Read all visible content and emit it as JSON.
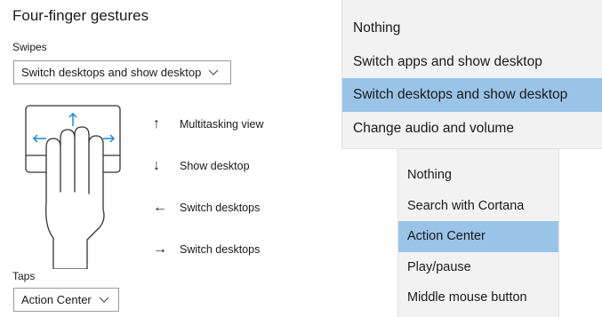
{
  "section_title": "Four-finger gestures",
  "swipes": {
    "label": "Swipes",
    "selected": "Switch desktops and show desktop"
  },
  "taps": {
    "label": "Taps",
    "selected": "Action Center"
  },
  "legend": [
    {
      "arrow": "↑",
      "icon": "arrow-up-icon",
      "label": "Multitasking view"
    },
    {
      "arrow": "↓",
      "icon": "arrow-down-icon",
      "label": "Show desktop"
    },
    {
      "arrow": "←",
      "icon": "arrow-left-icon",
      "label": "Switch desktops"
    },
    {
      "arrow": "→",
      "icon": "arrow-right-icon",
      "label": "Switch desktops"
    }
  ],
  "swipes_dropdown": {
    "options": [
      "Nothing",
      "Switch apps and show desktop",
      "Switch desktops and show desktop",
      "Change audio and volume"
    ],
    "selected_index": 2
  },
  "taps_dropdown": {
    "options": [
      "Nothing",
      "Search with Cortana",
      "Action Center",
      "Play/pause",
      "Middle mouse button"
    ],
    "selected_index": 2
  },
  "colors": {
    "selected_option": "#99c4e8",
    "dropdown_bg": "#f2f2f2",
    "gesture_arrow": "#1e86d4"
  }
}
